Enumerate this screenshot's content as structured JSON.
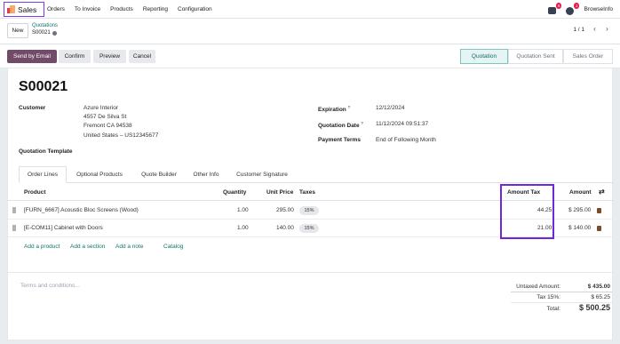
{
  "nav": {
    "app_name": "Sales",
    "menu": [
      "Orders",
      "To Invoice",
      "Products",
      "Reporting",
      "Configuration"
    ],
    "messages_badge": "6",
    "activities_badge": "1",
    "user": "BrowseInfo"
  },
  "control": {
    "new_label": "New",
    "breadcrumb_parent": "Quotations",
    "breadcrumb_current": "S00021",
    "pager": "1 / 1",
    "prev": "‹",
    "next": "›"
  },
  "actions": {
    "send_email": "Send by Email",
    "confirm": "Confirm",
    "preview": "Preview",
    "cancel": "Cancel",
    "stages": [
      "Quotation",
      "Quotation Sent",
      "Sales Order"
    ],
    "active_stage": "Quotation"
  },
  "form": {
    "title": "S00021",
    "customer_label": "Customer",
    "customer_lines": [
      "Azure Interior",
      "4557 De Silva St",
      "Fremont CA 94538",
      "United States – US12345677"
    ],
    "expiration_label": "Expiration",
    "expiration_value": "12/12/2024",
    "quotation_date_label": "Quotation Date",
    "quotation_date_value": "11/12/2024 09:51:37",
    "payment_terms_label": "Payment Terms",
    "payment_terms_value": "End of Following Month",
    "template_label": "Quotation Template",
    "help_mark": "?"
  },
  "tabs": [
    "Order Lines",
    "Optional Products",
    "Quote Builder",
    "Other Info",
    "Customer Signature"
  ],
  "table": {
    "headers": {
      "product": "Product",
      "quantity": "Quantity",
      "unit_price": "Unit Price",
      "taxes": "Taxes",
      "amount_tax": "Amount Tax",
      "amount": "Amount"
    },
    "rows": [
      {
        "product": "[FURN_6667] Acoustic Bloc Screens (Wood)",
        "quantity": "1.00",
        "unit_price": "295.00",
        "tax": "15%",
        "amount_tax": "44.25",
        "amount": "$ 295.00"
      },
      {
        "product": "[E-COM11] Cabinet with Doors",
        "quantity": "1.00",
        "unit_price": "140.00",
        "tax": "15%",
        "amount_tax": "21.00",
        "amount": "$ 140.00"
      }
    ],
    "add_product": "Add a product",
    "add_section": "Add a section",
    "add_note": "Add a note",
    "catalog": "Catalog"
  },
  "footer": {
    "terms_placeholder": "Terms and conditions...",
    "untaxed_label": "Untaxed Amount:",
    "untaxed_value": "$ 435.00",
    "tax_label": "Tax 15%:",
    "tax_value": "$ 65.25",
    "total_label": "Total:",
    "total_value": "$ 500.25"
  },
  "colors": {
    "brand": "#714b67",
    "highlight": "#6d28d9",
    "link": "#0f766e",
    "badge": "#e11d48"
  }
}
